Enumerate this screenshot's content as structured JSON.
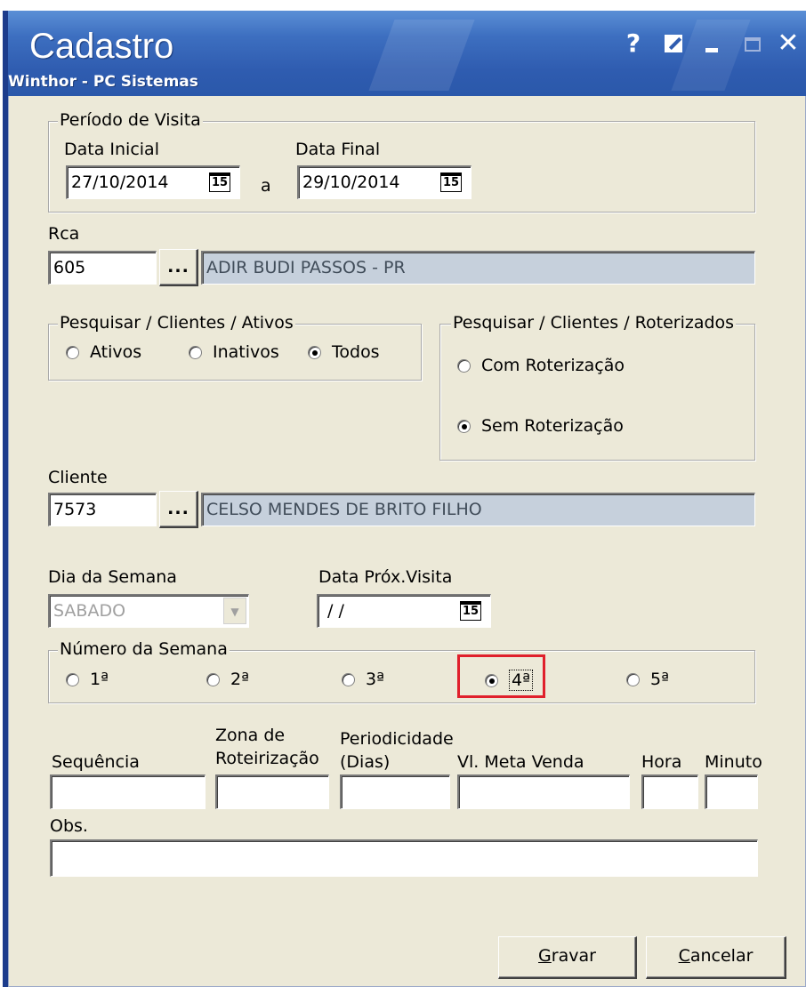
{
  "window": {
    "title": "Cadastro",
    "subtitle": "Winthor - PC Sistemas",
    "buttons": {
      "help": "?",
      "close": "✕"
    }
  },
  "periodo": {
    "title": "Período de Visita",
    "data_inicial_label": "Data Inicial",
    "data_inicial": "27/10/2014",
    "sep": "a",
    "data_final_label": "Data Final",
    "data_final": "29/10/2014",
    "cal_icon": "15"
  },
  "rca": {
    "label": "Rca",
    "code": "605",
    "dots": "...",
    "name": "ADIR BUDI PASSOS - PR"
  },
  "ativos": {
    "title": "Pesquisar / Clientes / Ativos",
    "options": [
      "Ativos",
      "Inativos",
      "Todos"
    ],
    "selected": "Todos"
  },
  "roterizados": {
    "title": "Pesquisar / Clientes / Roterizados",
    "options": [
      "Com Roterização",
      "Sem Roterização"
    ],
    "selected": "Sem Roterização"
  },
  "cliente": {
    "label": "Cliente",
    "code": "7573",
    "dots": "...",
    "name": "CELSO MENDES DE BRITO FILHO"
  },
  "dia_semana": {
    "label": "Dia da Semana",
    "value": "SABADO",
    "arrow": "▼"
  },
  "prox_visita": {
    "label": "Data Próx.Visita",
    "value": "/ /",
    "cal_icon": "15"
  },
  "numero_semana": {
    "title": "Número da Semana",
    "options": [
      "1ª",
      "2ª",
      "3ª",
      "4ª",
      "5ª"
    ],
    "selected": "4ª"
  },
  "fields": {
    "sequencia": "Sequência",
    "zona_1": "Zona de",
    "zona_2": "Roteirização",
    "periodicidade_1": "Periodicidade",
    "periodicidade_2": "(Dias)",
    "meta": "Vl. Meta Venda",
    "hora": "Hora",
    "minuto": "Minuto",
    "obs": "Obs."
  },
  "actions": {
    "save_u": "G",
    "save_rest": "ravar",
    "cancel_u": "C",
    "cancel_rest": "ancelar"
  },
  "colors": {
    "titlebar": "#2f5cb0",
    "dialog_bg": "#ece9d8",
    "readonly_bg": "#c6d0dc",
    "highlight": "#e0202c"
  }
}
